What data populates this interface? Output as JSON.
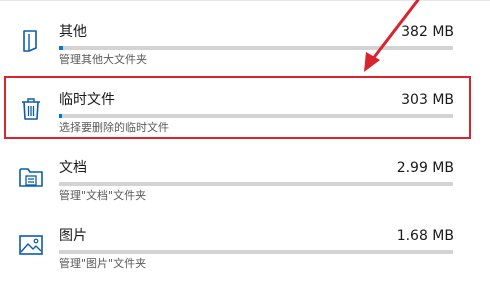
{
  "accent_color": "#0078d4",
  "annotation_color": "#d9232d",
  "items": [
    {
      "icon": "folder-doc-icon",
      "name": "其他",
      "size": "382 MB",
      "description": "管理其他大文件夹",
      "usage_fraction": 0.01
    },
    {
      "icon": "trash-icon",
      "name": "临时文件",
      "size": "303 MB",
      "description": "选择要删除的临时文件",
      "usage_fraction": 0.008
    },
    {
      "icon": "documents-folder-icon",
      "name": "文档",
      "size": "2.99 MB",
      "description": "管理\"文档\"文件夹",
      "usage_fraction": 0.0
    },
    {
      "icon": "pictures-icon",
      "name": "图片",
      "size": "1.68 MB",
      "description": "管理\"图片\"文件夹",
      "usage_fraction": 0.0
    }
  ]
}
